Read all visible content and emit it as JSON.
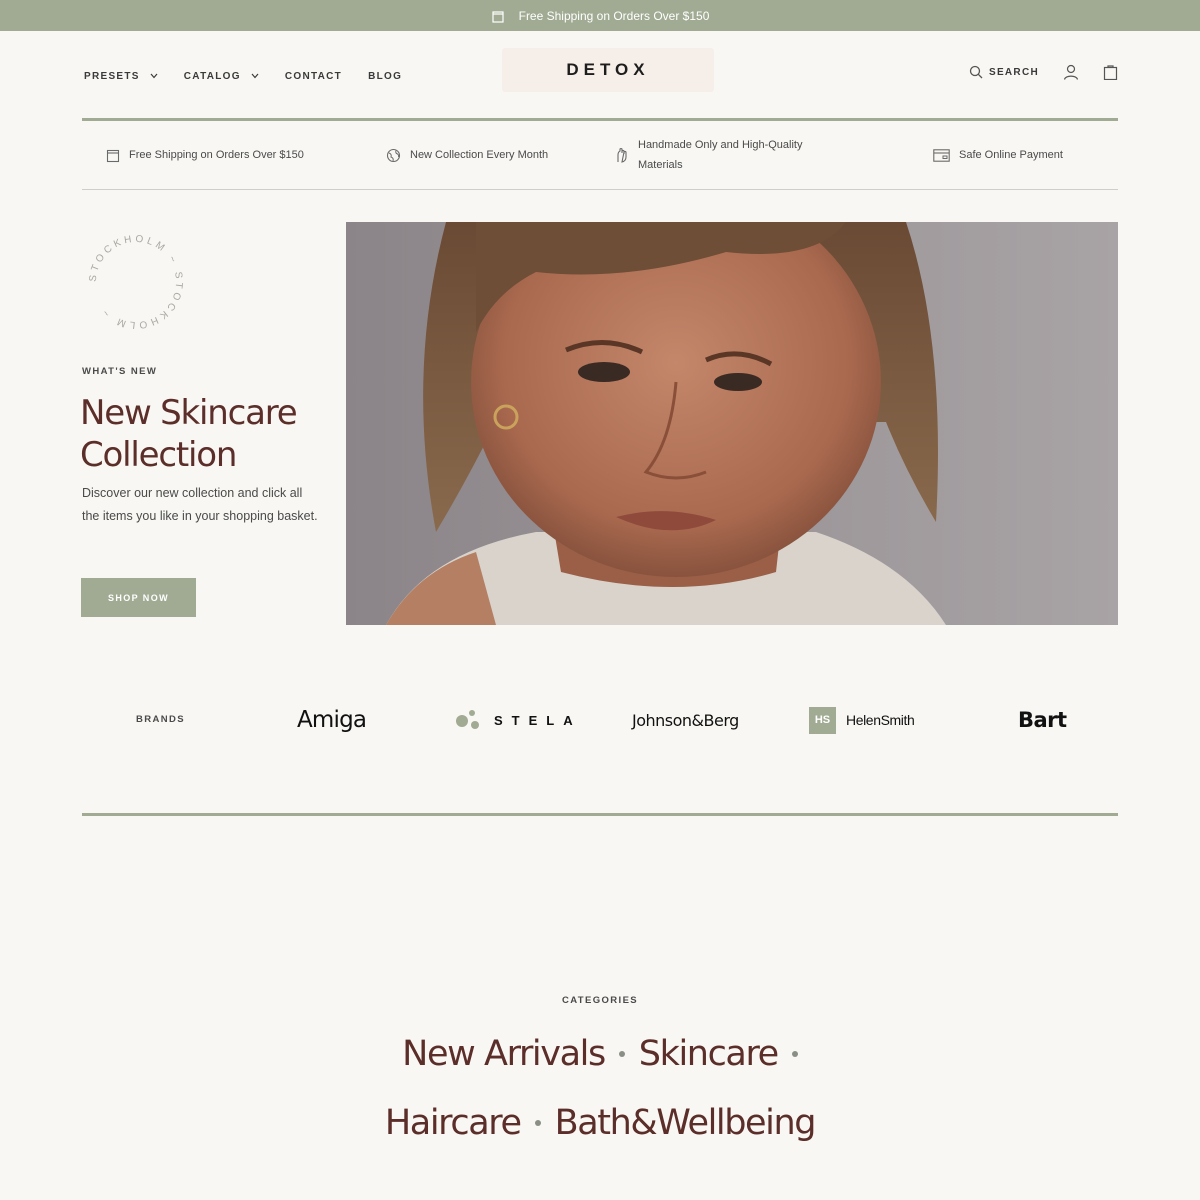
{
  "announcement": {
    "text": "Free Shipping on Orders Over $150",
    "icon": "bag-icon"
  },
  "nav": {
    "items": [
      {
        "label": "PRESETS",
        "has_dropdown": true
      },
      {
        "label": "CATALOG",
        "has_dropdown": true
      },
      {
        "label": "CONTACT",
        "has_dropdown": false
      },
      {
        "label": "BLOG",
        "has_dropdown": false
      }
    ],
    "logo": "DETOX",
    "search_label": "SEARCH",
    "icons": [
      "search-icon",
      "account-icon",
      "cart-icon"
    ]
  },
  "features": [
    {
      "text": "Free Shipping on Orders Over $150",
      "icon": "bag-icon"
    },
    {
      "text": "New Collection Every Month",
      "icon": "globe-icon"
    },
    {
      "text": "Handmade Only and High-Quality Materials",
      "icon": "hand-icon"
    },
    {
      "text": "Safe Online Payment",
      "icon": "card-icon"
    }
  ],
  "hero": {
    "badge_text": "STOCKHOLM ~ STOCKHOLM ~",
    "subtitle": "WHAT'S NEW",
    "title": "New Skincare Collection",
    "description": "Discover our new collection and click all the items you like in your shopping basket.",
    "button_label": "SHOP NOW"
  },
  "brands": {
    "label": "BRANDS",
    "items": [
      "Amiga",
      "STELA",
      "Johnson&Berg",
      "HelenSmith",
      "Bart"
    ],
    "helen_badge": "HS"
  },
  "categories": {
    "label": "CATEGORIES",
    "items": [
      "New Arrivals",
      "Skincare",
      "Haircare",
      "Bath&Wellbeing"
    ]
  },
  "colors": {
    "accent": "#a1ab93",
    "heading": "#5c2e2a",
    "background": "#f8f7f3"
  }
}
